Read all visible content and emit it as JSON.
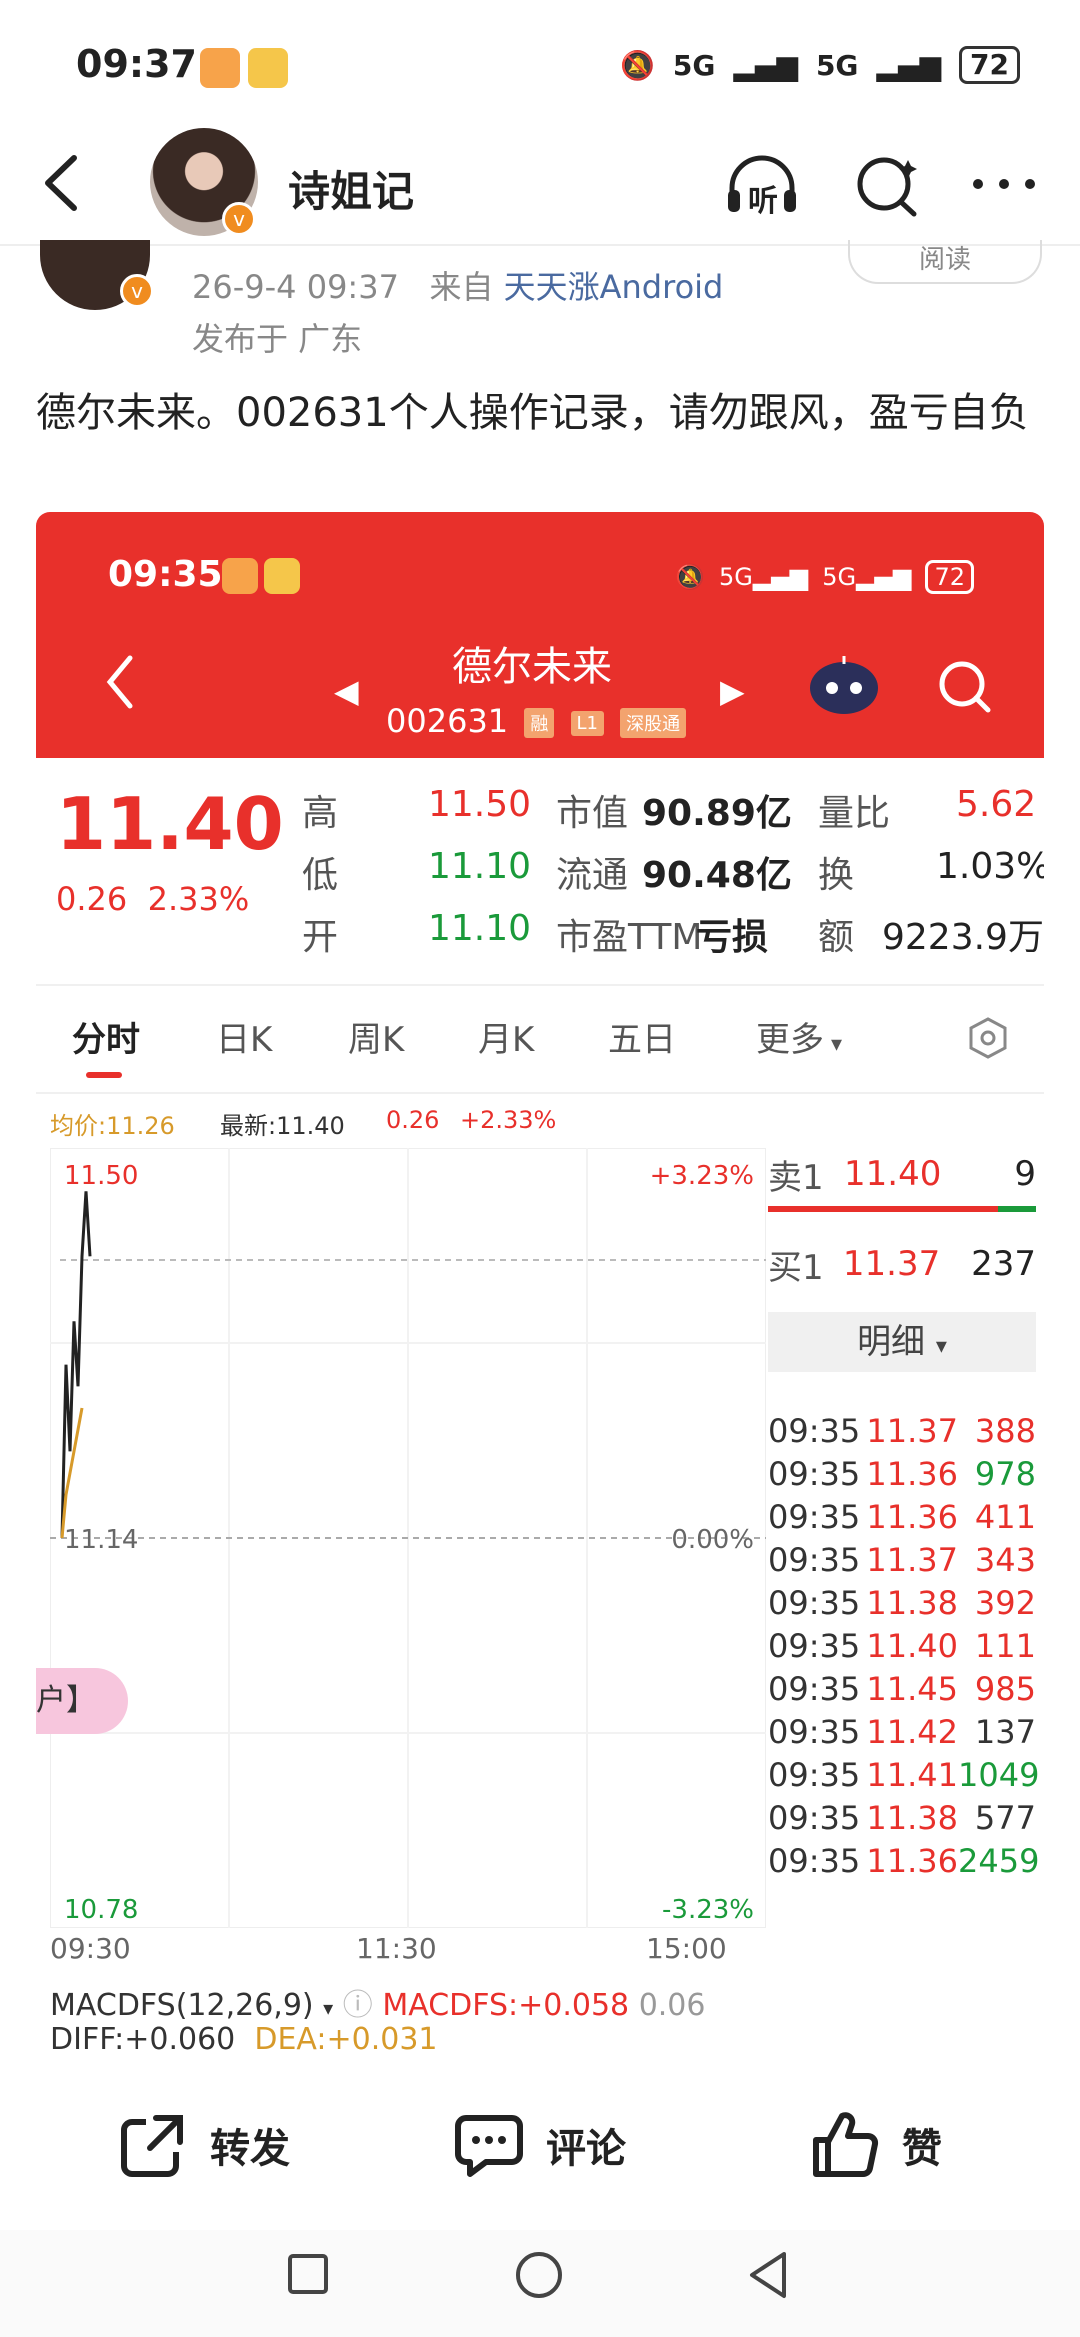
{
  "status_bar": {
    "time": "09:37",
    "network1": "5G",
    "network2": "5G",
    "battery": "72"
  },
  "header": {
    "title": "诗姐记",
    "listen_label": "听"
  },
  "post": {
    "date": "26-9-4 09:37",
    "from_prefix": "来自",
    "source": "天天涨Android",
    "location": "发布于 广东",
    "read_label": "阅读",
    "text": "德尔未来。002631个人操作记录，请勿跟风，盈亏自负"
  },
  "embedded": {
    "status_time": "09:35",
    "battery": "72",
    "stock_name": "德尔未来",
    "stock_code": "002631",
    "tags": [
      "融",
      "L1",
      "深股通"
    ],
    "price": "11.40",
    "change": "0.26",
    "change_pct": "2.33%",
    "quote": [
      {
        "label": "高",
        "value": "11.50",
        "label2": "市值",
        "value2": "90.89亿",
        "label3": "量比",
        "value3": "5.62"
      },
      {
        "label": "低",
        "value": "11.10",
        "label2": "流通",
        "value2": "90.48亿",
        "label3": "换",
        "value3": "1.03%"
      },
      {
        "label": "开",
        "value": "11.10",
        "label2": "市盈TTM",
        "value2": "亏损",
        "label3": "额",
        "value3": "9223.9万"
      }
    ],
    "tabs": [
      "分时",
      "日K",
      "周K",
      "月K",
      "五日",
      "更多"
    ],
    "info": {
      "avg_label": "均价:",
      "avg": "11.26",
      "latest_label": "最新:",
      "latest": "11.40",
      "chg": "0.26",
      "chg_pct": "+2.33%"
    },
    "chart_data": {
      "type": "line",
      "x_ticks": [
        "09:30",
        "11:30",
        "15:00"
      ],
      "ylim": [
        10.78,
        11.5
      ],
      "y_ticks": [
        "11.50",
        "11.14",
        "10.78"
      ],
      "pct_ticks": [
        "+3.23%",
        "0.00%",
        "-3.23%"
      ],
      "series": [
        {
          "values": [
            11.14,
            11.3,
            11.22,
            11.34,
            11.28,
            11.4,
            11.46,
            11.4
          ]
        },
        {
          "values": [
            11.14,
            11.18,
            11.2,
            11.22,
            11.24,
            11.26
          ]
        }
      ]
    },
    "macd": {
      "name": "MACDFS(12,26,9)",
      "macd_val": "MACDFS:+0.058",
      "extra": "0.06",
      "diff": "DIFF:+0.060",
      "dea": "DEA:+0.031"
    },
    "pill_text": "户】",
    "orderbook": {
      "sell_label": "卖1",
      "sell_price": "11.40",
      "sell_vol": "9",
      "buy_label": "买1",
      "buy_price": "11.37",
      "buy_vol": "237",
      "detail_label": "明细"
    },
    "trades": [
      {
        "time": "09:35",
        "price": "11.37",
        "vol": "388",
        "up": true
      },
      {
        "time": "09:35",
        "price": "11.36",
        "vol": "978",
        "up": false
      },
      {
        "time": "09:35",
        "price": "11.36",
        "vol": "411",
        "up": true
      },
      {
        "time": "09:35",
        "price": "11.37",
        "vol": "343",
        "up": true
      },
      {
        "time": "09:35",
        "price": "11.38",
        "vol": "392",
        "up": true
      },
      {
        "time": "09:35",
        "price": "11.40",
        "vol": "111",
        "up": true
      },
      {
        "time": "09:35",
        "price": "11.45",
        "vol": "985",
        "up": true
      },
      {
        "time": "09:35",
        "price": "11.42",
        "vol": "137",
        "up": null
      },
      {
        "time": "09:35",
        "price": "11.41",
        "vol": "1049",
        "up": false
      },
      {
        "time": "09:35",
        "price": "11.38",
        "vol": "577",
        "up": null
      },
      {
        "time": "09:35",
        "price": "11.36",
        "vol": "2459",
        "up": false
      }
    ]
  },
  "actions": {
    "repost": "转发",
    "comment": "评论",
    "like": "赞"
  },
  "colors": {
    "red": "#e8302b",
    "green": "#1a9a3a",
    "orange": "#f08c1f",
    "link": "#4a6aa0"
  }
}
